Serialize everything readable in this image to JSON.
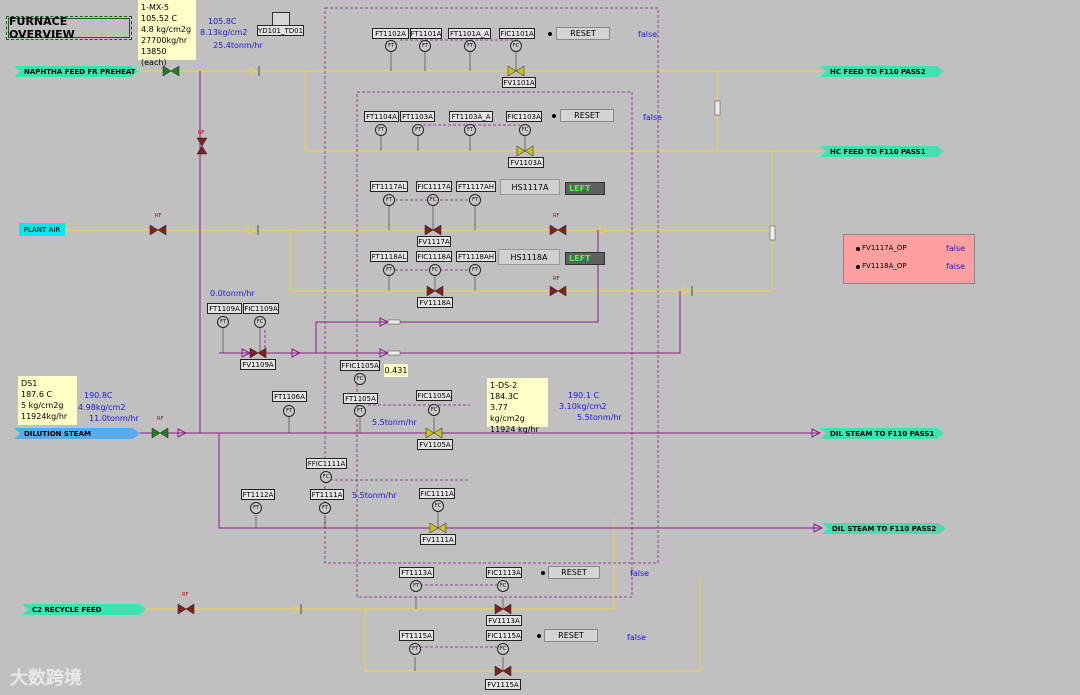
{
  "title": "FURNACE OVERVIEW",
  "mx5": {
    "lines": [
      "1-MX-5",
      "105.52 C",
      "4.8 kg/cm2g",
      "27700kg/hr",
      "13850 (each)"
    ],
    "readings": [
      "105.8C",
      "8.13kg/cm2",
      "25.4tonm/hr"
    ]
  },
  "td_tag": "YD101_TD01",
  "streams_in": {
    "naphtha": "NAPHTHA FEED FR PREHEAT",
    "plant_air": "PLANT AIR",
    "dilution": "DILUTION STEAM",
    "c2": "C2 RECYCLE FEED"
  },
  "streams_out": {
    "hc2": "HC FEED TO F110 PASS2",
    "hc1": "HC FEED TO F110 PASS1",
    "dil1": "DIL STEAM TO F110 PASS1",
    "dil2": "DIL STEAM TO F110 PASS2"
  },
  "ds1": {
    "lines": [
      "DS1",
      "187.6 C",
      "5  kg/cm2g",
      "11924kg/hr"
    ],
    "readings": [
      "190.8C",
      "4.98kg/cm2",
      "11.0tonm/hr"
    ]
  },
  "ds2": {
    "lines": [
      "1-DS-2",
      "184.3C",
      "3.77  kg/cm2g",
      "11924 kg/hr"
    ],
    "readings": [
      "190.1 C",
      "3.10kg/cm2",
      "5.5tonm/hr"
    ]
  },
  "group_1101": {
    "tags": [
      "FT1102A",
      "FT1101A",
      "FT1101A_A",
      "FIC1101A"
    ],
    "valve": "FV1101A",
    "reset": "RESET",
    "status": "false"
  },
  "group_1103": {
    "tags": [
      "FT1104A",
      "FT1103A",
      "FT1103A_A",
      "FIC1103A"
    ],
    "valve": "FV1103A",
    "reset": "RESET",
    "status": "false"
  },
  "group_1117": {
    "tags": [
      "FT1117AL",
      "FIC1117A",
      "FT1117AH"
    ],
    "valve": "FV1117A",
    "hs": "HS1117A",
    "left": "LEFT"
  },
  "group_1118": {
    "tags": [
      "FT1118AL",
      "FIC1118A",
      "FT1118AH"
    ],
    "valve": "FV1118A",
    "hs": "HS1118A",
    "left": "LEFT"
  },
  "group_1109": {
    "flow": "0.0tonm/hr",
    "tags": [
      "FT1109A",
      "FIC1109A"
    ],
    "valve": "FV1109A"
  },
  "group_1105": {
    "ffic": "FFIC1105A",
    "ratio": "0.431",
    "tags": [
      "FT1106A",
      "FT1105A",
      "FIC1105A"
    ],
    "flow": "5.5tonm/hr",
    "valve": "FV1105A"
  },
  "group_1111": {
    "ffic": "FFIC1111A",
    "tags": [
      "FT1112A",
      "FT1111A",
      "FIC1111A"
    ],
    "flow": "5.5tonm/hr",
    "valve": "FV1111A"
  },
  "group_1113": {
    "tags": [
      "FT1113A",
      "FIC1113A"
    ],
    "valve": "FV1113A",
    "reset": "RESET",
    "status": "false"
  },
  "group_1115": {
    "tags": [
      "FT1115A",
      "FIC1115A"
    ],
    "valve": "FV1115A",
    "reset": "RESET",
    "status": "false"
  },
  "ops": {
    "items": [
      {
        "label": "FV1117A_OP",
        "value": "false"
      },
      {
        "label": "FV1118A_OP",
        "value": "false"
      }
    ]
  },
  "rf_label": "RF",
  "ft_label": "FT",
  "fc_label": "FC",
  "watermark": "大数跨境",
  "colors": {
    "process_line": "#e8d060",
    "signal_line": "#8b1a8b",
    "feed_stream": "#40e0b0",
    "steam_stream": "#5aaaf0"
  }
}
